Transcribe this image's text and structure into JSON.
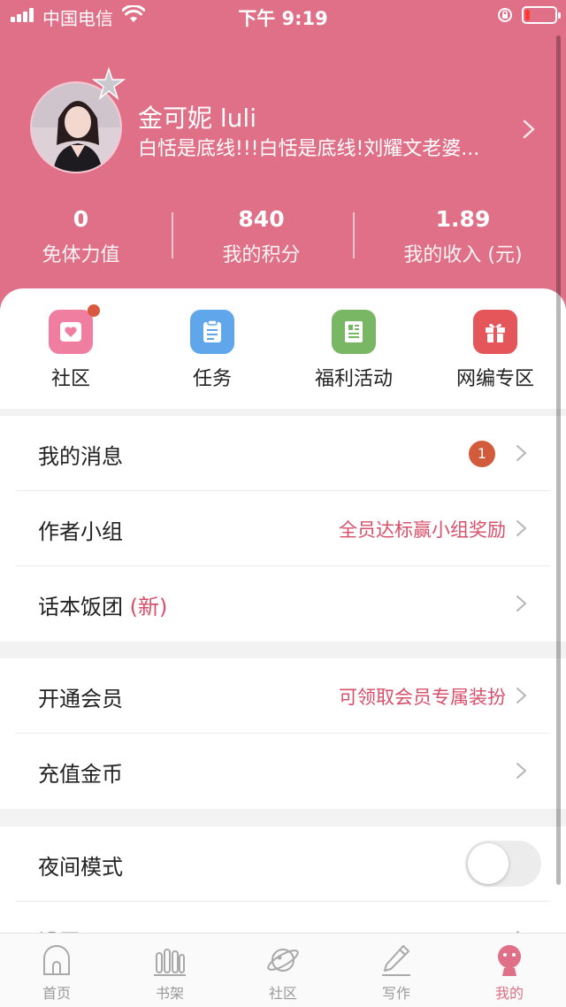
{
  "status_bar": {
    "carrier": "中国电信",
    "time": "下午 9:19"
  },
  "profile": {
    "name": "金可妮 luli",
    "bio": "白恬是底线!!!白恬是底线!刘耀文老婆..."
  },
  "stats": [
    {
      "value": "0",
      "label": "免体力值"
    },
    {
      "value": "840",
      "label": "我的积分"
    },
    {
      "value": "1.89",
      "label": "我的收入 (元)"
    }
  ],
  "quick_entries": [
    {
      "label": "社区",
      "icon": "heart-card-icon",
      "color": "#ef7ea0",
      "has_dot": true
    },
    {
      "label": "任务",
      "icon": "clipboard-icon",
      "color": "#5fa6ea",
      "has_dot": false
    },
    {
      "label": "福利活动",
      "icon": "document-icon",
      "color": "#79b765",
      "has_dot": false
    },
    {
      "label": "网编专区",
      "icon": "gift-icon",
      "color": "#e4565a",
      "has_dot": false
    }
  ],
  "menu": {
    "messages": {
      "title": "我的消息",
      "badge": "1"
    },
    "author_group": {
      "title": "作者小组",
      "extra": "全员达标赢小组奖励"
    },
    "fan_group": {
      "title": "话本饭团",
      "new_tag": "(新)"
    },
    "vip": {
      "title": "开通会员",
      "extra": "可领取会员专属装扮"
    },
    "recharge": {
      "title": "充值金币"
    },
    "night_mode": {
      "title": "夜间模式",
      "enabled": false
    },
    "settings": {
      "title": "设置"
    }
  },
  "tabbar": [
    {
      "label": "首页",
      "icon": "home-icon",
      "active": false
    },
    {
      "label": "书架",
      "icon": "bookshelf-icon",
      "active": false
    },
    {
      "label": "社区",
      "icon": "planet-icon",
      "active": false
    },
    {
      "label": "写作",
      "icon": "pen-icon",
      "active": false
    },
    {
      "label": "我的",
      "icon": "profile-icon",
      "active": true
    }
  ],
  "colors": {
    "brand": "#e07088",
    "accent_text": "#d94f6a",
    "badge": "#d25b3c"
  }
}
